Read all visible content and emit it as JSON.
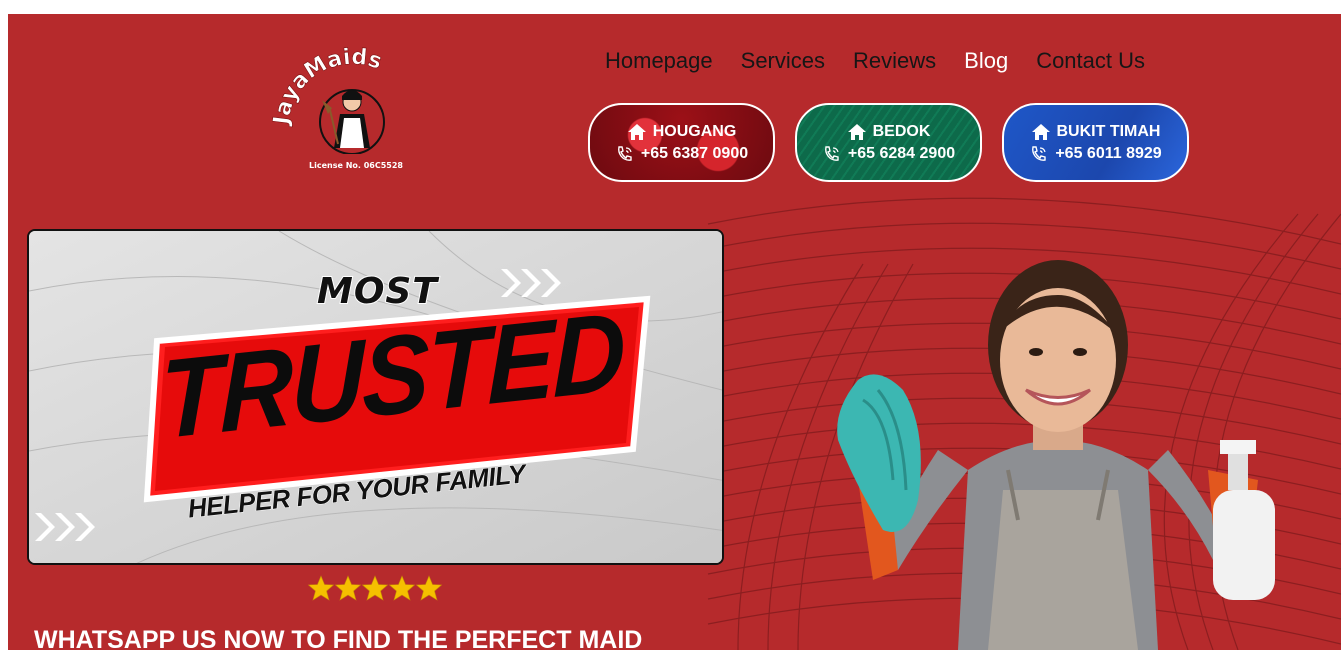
{
  "brand": {
    "logo_text": "JayaMaids",
    "license": "License No. 06C5528"
  },
  "nav": {
    "items": [
      {
        "label": "Homepage",
        "active": false
      },
      {
        "label": "Services",
        "active": false
      },
      {
        "label": "Reviews",
        "active": false
      },
      {
        "label": "Blog",
        "active": true
      },
      {
        "label": "Contact Us",
        "active": false
      }
    ]
  },
  "branches": [
    {
      "name": "HOUGANG",
      "phone": "+65 6387 0900",
      "icon": "home-icon",
      "phone_icon": "phone-call-icon",
      "color": "#8e1117"
    },
    {
      "name": "BEDOK",
      "phone": "+65 6284 2900",
      "icon": "home-icon",
      "phone_icon": "phone-call-icon",
      "color": "#0d6a4a"
    },
    {
      "name": "BUKIT TIMAH",
      "phone": "+65 6011 8929",
      "icon": "home-icon",
      "phone_icon": "phone-call-icon",
      "color": "#1f57c8"
    }
  ],
  "banner": {
    "line1": "MOST",
    "line2": "TRUSTED",
    "line3": "HELPER FOR YOUR FAMILY"
  },
  "rating": {
    "stars": 5,
    "max": 5,
    "color": "#f5c000"
  },
  "cta": "WHATSAPP US NOW TO FIND THE PERFECT MAID",
  "colors": {
    "background": "#b62a2c",
    "nav_text": "#161616",
    "nav_active": "#ffffff"
  }
}
